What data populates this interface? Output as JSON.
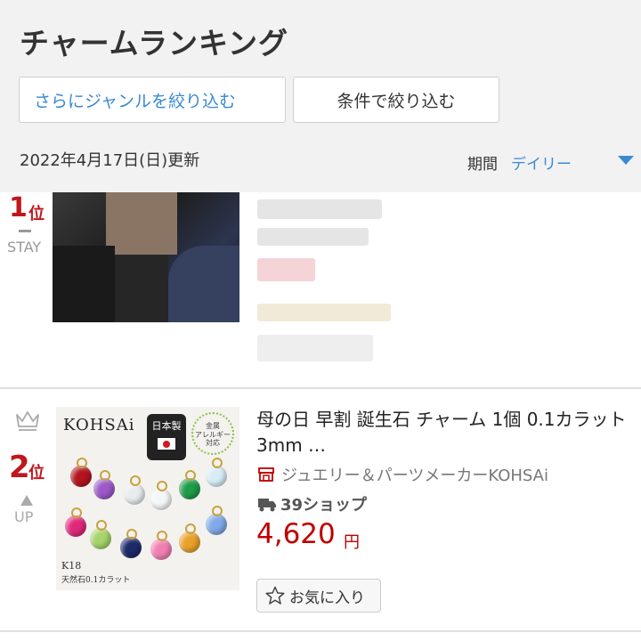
{
  "header": {
    "title": "チャームランキング",
    "genre_filter_label": "さらにジャンルを絞り込む",
    "condition_filter_label": "条件で絞り込む",
    "updated": "2022年4月17日(日)更新",
    "period_label": "期間",
    "period_value": "デイリー"
  },
  "items": [
    {
      "rank": "1",
      "rank_suffix": "位",
      "movement": "STAY"
    },
    {
      "rank": "2",
      "rank_suffix": "位",
      "movement": "UP",
      "title": "母の日 早割 誕生石 チャーム 1個 0.1カラット 3mm …",
      "store": "ジュエリー＆パーツメーカーKOHSAi",
      "shipping": "39ショップ",
      "price": "4,620",
      "price_unit": "円",
      "favorite_label": "お気に入り",
      "image_text": {
        "brand": "KOHSAi",
        "made_in": "日本製",
        "allergy_line1": "金属",
        "allergy_line2": "アレルギー",
        "allergy_line3": "対応",
        "karat": "K18",
        "stone_note": "天然石0.1カラット"
      }
    }
  ],
  "colors": {
    "accent_blue": "#3a8ad3",
    "rank_red": "#c0171c",
    "price_red": "#bf0000"
  }
}
